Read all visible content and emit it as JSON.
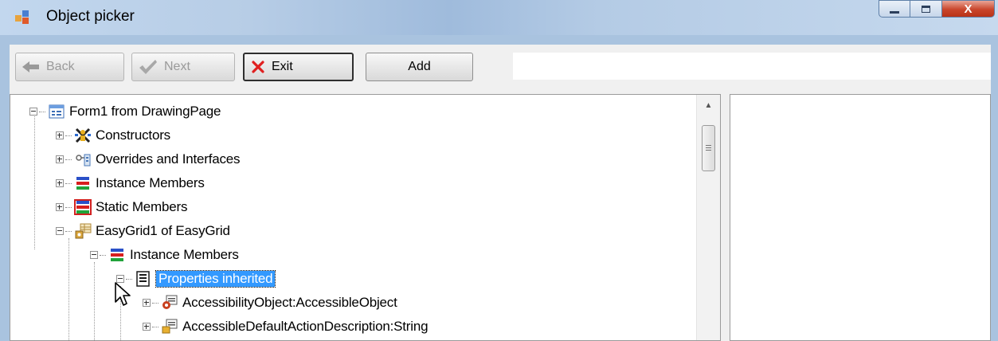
{
  "window": {
    "title": "Object picker",
    "close_glyph": "X"
  },
  "toolbar": {
    "back_label": "Back",
    "next_label": "Next",
    "exit_label": "Exit",
    "add_label": "Add",
    "path_value": ""
  },
  "tree": {
    "nodes": [
      {
        "label": "Form1 from DrawingPage",
        "icon": "form-icon",
        "state": "expanded"
      },
      {
        "label": "Constructors",
        "icon": "constructor-icon",
        "state": "collapsed"
      },
      {
        "label": "Overrides and Interfaces",
        "icon": "interface-icon",
        "state": "collapsed"
      },
      {
        "label": "Instance Members",
        "icon": "instance-members-icon",
        "state": "collapsed"
      },
      {
        "label": "Static Members",
        "icon": "static-members-icon",
        "state": "collapsed"
      },
      {
        "label": "EasyGrid1 of EasyGrid",
        "icon": "grid-object-icon",
        "state": "expanded"
      },
      {
        "label": "Instance Members",
        "icon": "instance-members-icon",
        "state": "expanded"
      },
      {
        "label": "Properties inherited",
        "icon": "properties-icon",
        "state": "expanded",
        "selected": true
      },
      {
        "label": "AccessibilityObject:AccessibleObject",
        "icon": "property-object-icon",
        "state": "collapsed"
      },
      {
        "label": "AccessibleDefaultActionDescription:String",
        "icon": "property-string-icon",
        "state": "collapsed"
      }
    ]
  },
  "colors": {
    "selection": "#3399ff",
    "close_button": "#c9452b",
    "exit_icon": "#e02020"
  }
}
